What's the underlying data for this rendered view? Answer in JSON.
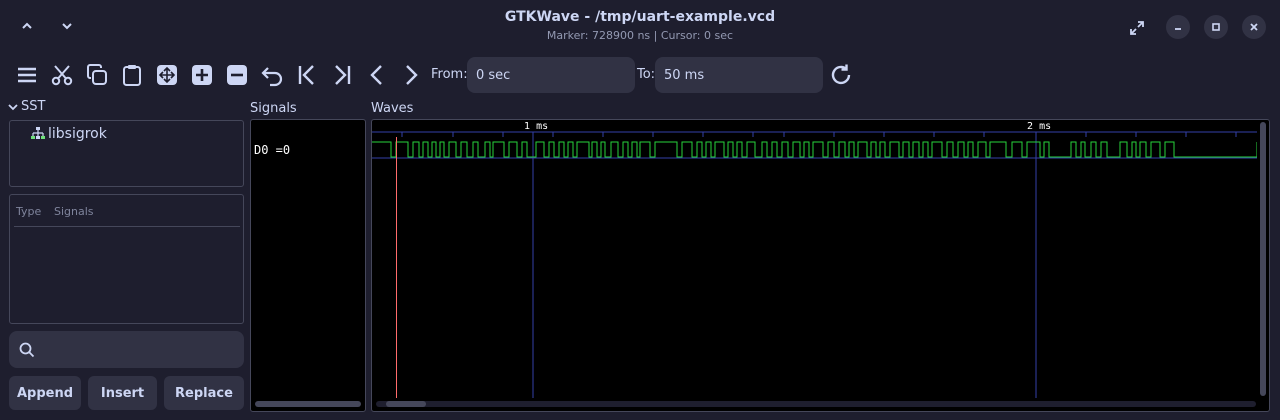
{
  "window": {
    "title": "GTKWave - /tmp/uart-example.vcd",
    "subtitle": "Marker: 728900 ns  |  Cursor: 0 sec"
  },
  "toolbar": {
    "from_label": "From:",
    "from_value": "0 sec",
    "to_label": "To:",
    "to_value": "50 ms"
  },
  "sst": {
    "title": "SST",
    "tree": [
      {
        "label": "libsigrok"
      }
    ],
    "columns": [
      "Type",
      "Signals"
    ],
    "search_placeholder": ""
  },
  "actions": {
    "append": "Append",
    "insert": "Insert",
    "replace": "Replace"
  },
  "signals": {
    "title": "Signals",
    "rows": [
      {
        "label": "D0 =0"
      }
    ]
  },
  "waves": {
    "title": "Waves",
    "ticks": [
      {
        "label": "1",
        "unit": "ms"
      },
      {
        "label": "2",
        "unit": "ms"
      }
    ],
    "colors": {
      "wave": "#27d33b",
      "marker": "#ff6b6b",
      "grid": "#3340a8"
    }
  }
}
